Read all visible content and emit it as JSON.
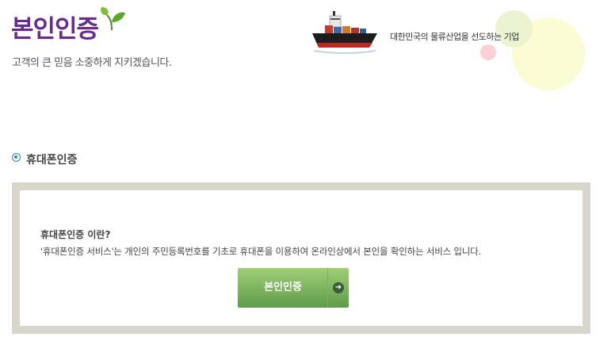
{
  "header": {
    "title": "본인인증",
    "subtitle": "고객의 큰 믿음 소중하게 지키겠습니다.",
    "slogan": "대한민국의 물류산업을 선도하는 기업"
  },
  "section": {
    "title": "휴대폰인증"
  },
  "info": {
    "question": "휴대폰인증 이란?",
    "description": "'휴대폰인증 서비스'는 개인의 주민등록번호를 기초로 휴대폰을 이용하여 온라인상에서 본인을 확인하는 서비스 입니다."
  },
  "button": {
    "label": "본인인증",
    "icon": "arrow-right-icon"
  },
  "colors": {
    "title": "#6a2c8c",
    "radio": "#2e8bb0",
    "frame": "#d9d6cb",
    "button_top": "#9fcf75",
    "button_bottom": "#5f9b4a"
  }
}
